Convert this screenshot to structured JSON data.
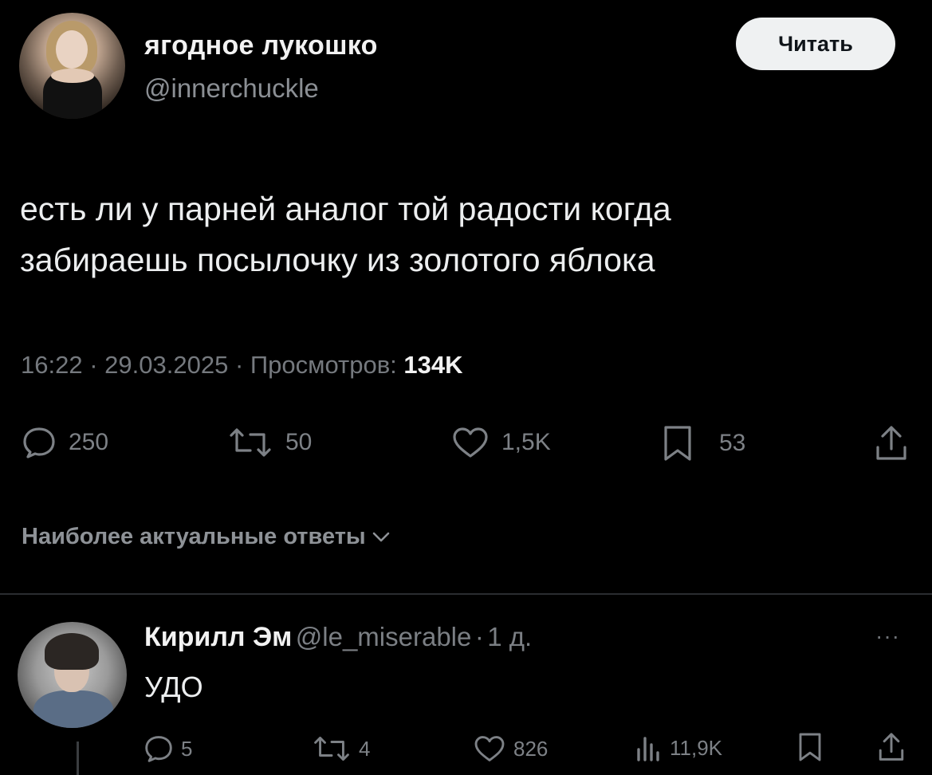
{
  "tweet": {
    "author": {
      "display_name": "ягодное лукошко",
      "handle": "@innerchuckle"
    },
    "follow_label": "Читать",
    "text_line1": "есть ли у парней аналог той радости когда",
    "text_line2": "забираешь посылочку из золотого яблока",
    "time": "16:22",
    "date": "29.03.2025",
    "views_label": "Просмотров:",
    "views_count": "134K",
    "separator": "·",
    "actions": {
      "replies": "250",
      "retweets": "50",
      "likes": "1,5K",
      "bookmarks": "53"
    }
  },
  "replies_section": {
    "sort_label": "Наиболее актуальные ответы"
  },
  "reply": {
    "display_name": "Кирилл Эм",
    "handle": "@le_miserable",
    "time_ago": "1 д.",
    "text": "УДО",
    "more": "···",
    "actions": {
      "replies": "5",
      "retweets": "4",
      "likes": "826",
      "views": "11,9K"
    }
  },
  "colors": {
    "background": "#000000",
    "primary_text": "#e7e9ea",
    "secondary_text": "#7d8186",
    "button_bg": "#eff1f2",
    "divider": "#2a2d30"
  }
}
